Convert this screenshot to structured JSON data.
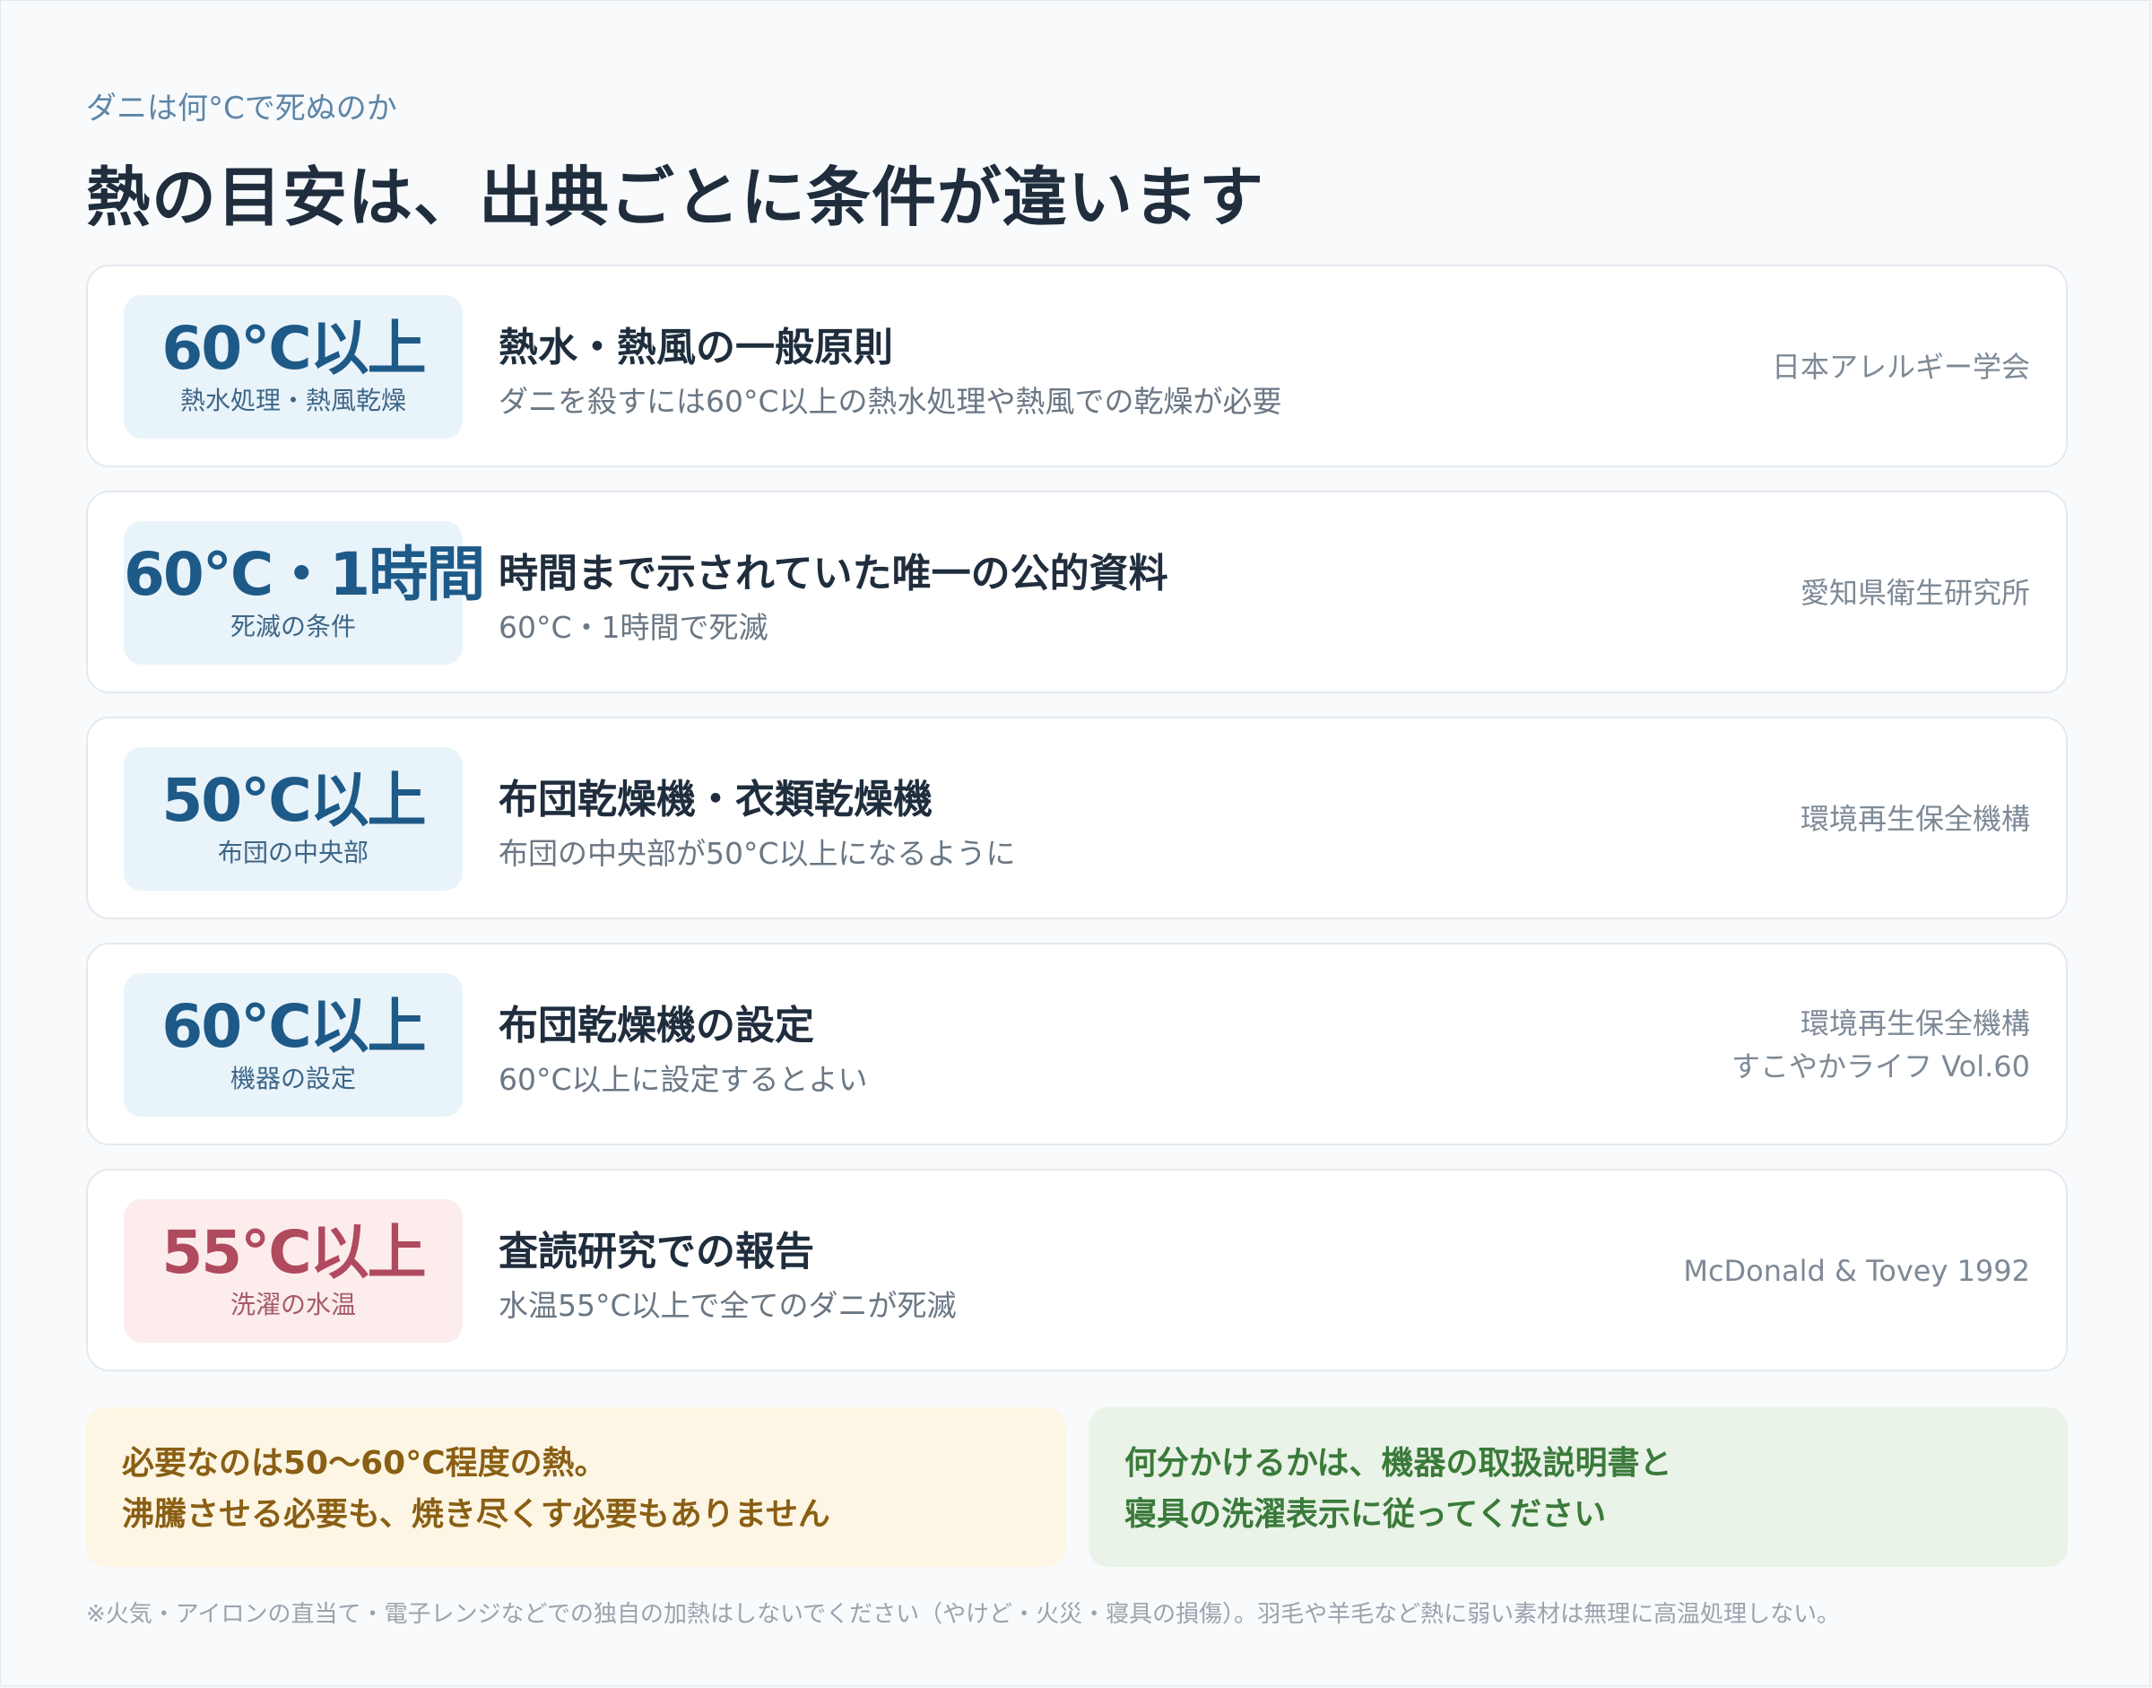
{
  "header": {
    "kicker": "ダニは何°Cで死ぬのか",
    "title": "熱の目安は、出典ごとに条件が違います"
  },
  "cards": [
    {
      "badge_value": "60°C以上",
      "badge_label": "熱水処理・熱風乾燥",
      "title": "熱水・熱風の一般原則",
      "desc": "ダニを殺すには60°C以上の熱水処理や熱風での乾燥が必要",
      "source_line1": "日本アレルギー学会",
      "source_line2": ""
    },
    {
      "badge_value": "60°C・1時間",
      "badge_label": "死滅の条件",
      "title": "時間まで示されていた唯一の公的資料",
      "desc": "60°C・1時間で死滅",
      "source_line1": "愛知県衛生研究所",
      "source_line2": ""
    },
    {
      "badge_value": "50°C以上",
      "badge_label": "布団の中央部",
      "title": "布団乾燥機・衣類乾燥機",
      "desc": "布団の中央部が50°C以上になるように",
      "source_line1": "環境再生保全機構",
      "source_line2": ""
    },
    {
      "badge_value": "60°C以上",
      "badge_label": "機器の設定",
      "title": "布団乾燥機の設定",
      "desc": "60°C以上に設定するとよい",
      "source_line1": "環境再生保全機構",
      "source_line2": "すこやかライフ Vol.60"
    },
    {
      "badge_value": "55°C以上",
      "badge_label": "洗濯の水温",
      "title": "査読研究での報告",
      "desc": "水温55°C以上で全てのダニが死滅",
      "source_line1": "McDonald & Tovey 1992",
      "source_line2": ""
    }
  ],
  "notes": {
    "yellow_line1": "必要なのは50〜60°C程度の熱。",
    "yellow_line2": "沸騰させる必要も、焼き尽くす必要もありません",
    "green_line1": "何分かけるかは、機器の取扱説明書と",
    "green_line2": "寝具の洗濯表示に従ってください"
  },
  "footnote": "※火気・アイロンの直当て・電子レンジなどでの独自の加熱はしないでください（やけど・火災・寝具の損傷）。羽毛や羊毛など熱に弱い素材は無理に高温処理しない。",
  "colors": {
    "accent_blue": "#1e5a88",
    "accent_red": "#b04a5e",
    "note_yellow_text": "#8a5f14",
    "note_green_text": "#3a7a3a"
  }
}
